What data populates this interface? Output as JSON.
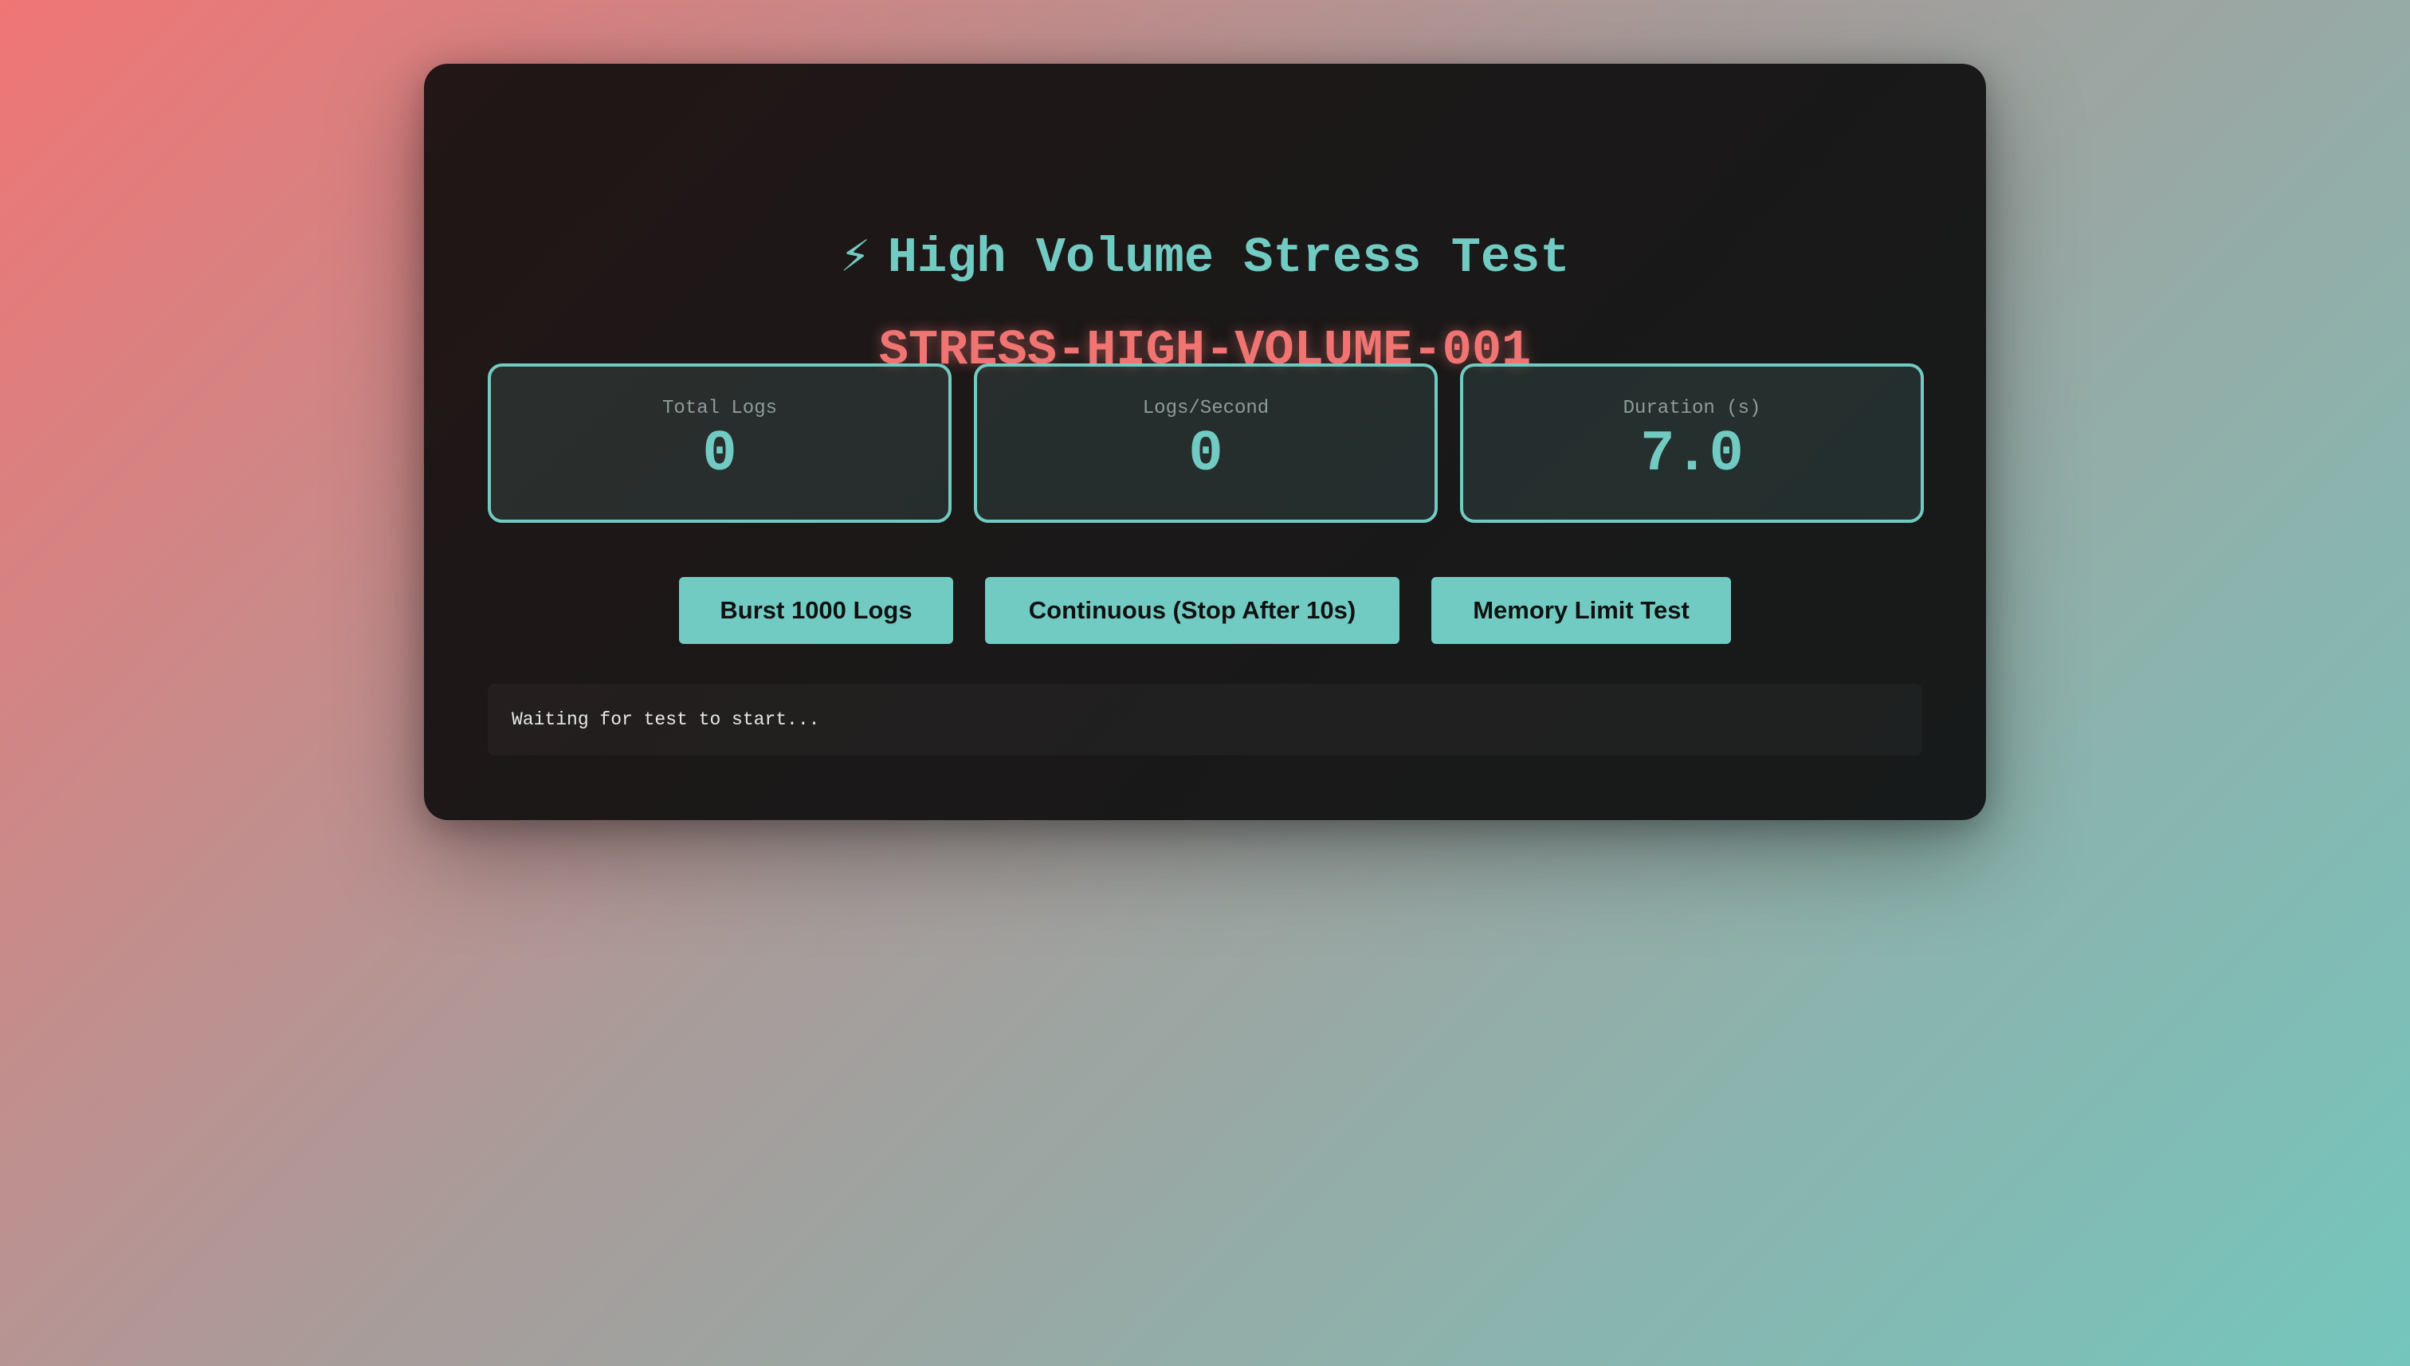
{
  "header": {
    "icon": "lightning-bolt-icon",
    "bolt_glyph": "⚡",
    "title": "High Volume Stress Test",
    "test_id": "STRESS-HIGH-VOLUME-001"
  },
  "stats": [
    {
      "label": "Total Logs",
      "value": "0"
    },
    {
      "label": "Logs/Second",
      "value": "0"
    },
    {
      "label": "Duration (s)",
      "value": "7.0"
    }
  ],
  "buttons": {
    "burst_label": "Burst 1000 Logs",
    "continuous_label": "Continuous (Stop After 10s)",
    "memory_label": "Memory Limit Test"
  },
  "log": {
    "status_text": "Waiting for test to start..."
  },
  "colors": {
    "accent": "#72cbc2",
    "test_id": "#ef7472",
    "panel_bg": "#1b1818",
    "background_start": "#f07575",
    "background_end": "#74c6bd"
  }
}
